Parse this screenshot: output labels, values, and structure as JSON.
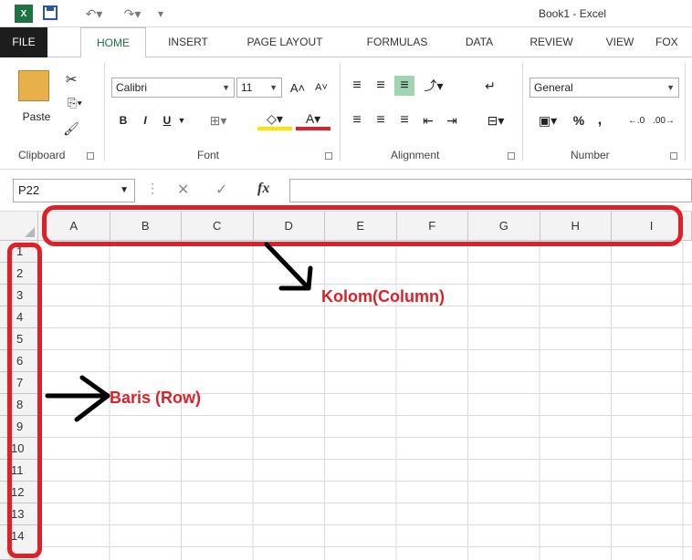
{
  "window": {
    "title": "Book1 - Excel"
  },
  "tabs": [
    "FILE",
    "HOME",
    "INSERT",
    "PAGE LAYOUT",
    "FORMULAS",
    "DATA",
    "REVIEW",
    "VIEW",
    "FOX"
  ],
  "ribbon": {
    "clipboard": {
      "label": "Clipboard",
      "paste_label": "Paste"
    },
    "font": {
      "label": "Font",
      "family": "Calibri",
      "size": "11",
      "bold": "B",
      "italic": "I",
      "underline": "U"
    },
    "alignment": {
      "label": "Alignment"
    },
    "number": {
      "label": "Number",
      "format": "General",
      "percent": "%",
      "comma": ","
    }
  },
  "formula_bar": {
    "name_box": "P22",
    "fx": "fx",
    "value": ""
  },
  "grid": {
    "columns": [
      "A",
      "B",
      "C",
      "D",
      "E",
      "F",
      "G",
      "H",
      "I"
    ],
    "rows": [
      "1",
      "2",
      "3",
      "4",
      "5",
      "6",
      "7",
      "8",
      "9",
      "10",
      "11",
      "12",
      "13",
      "14"
    ]
  },
  "annotations": {
    "column_label": "Kolom(Column)",
    "row_label": "Baris (Row)",
    "color": "#e01f26"
  },
  "colors": {
    "excel_green": "#1f7244",
    "file_tab": "#1d1d1d",
    "header_bg": "#f3f3f3"
  }
}
